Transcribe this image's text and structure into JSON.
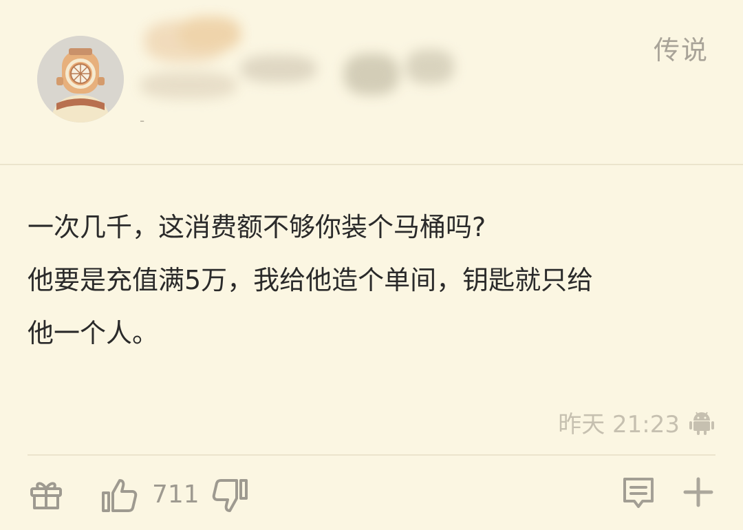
{
  "header": {
    "rank_badge": "传说",
    "level_line": "-"
  },
  "comment": {
    "lines": [
      "一次几千，这消费额不够你装个马桶吗?",
      "他要是充值满5万，我给他造个单间，钥匙就只给",
      "他一个人。"
    ]
  },
  "meta": {
    "timestamp": "昨天 21:23",
    "platform_icon": "android-icon"
  },
  "actions": {
    "like_count": "711",
    "icons": [
      "gift-icon",
      "thumbs-up-icon",
      "thumbs-down-icon",
      "reply-icon",
      "plus-icon"
    ]
  },
  "colors": {
    "background": "#fbf6e2",
    "text": "#2a2a2a",
    "muted": "#9e9a90",
    "avatar_ring": "#d5a378"
  }
}
